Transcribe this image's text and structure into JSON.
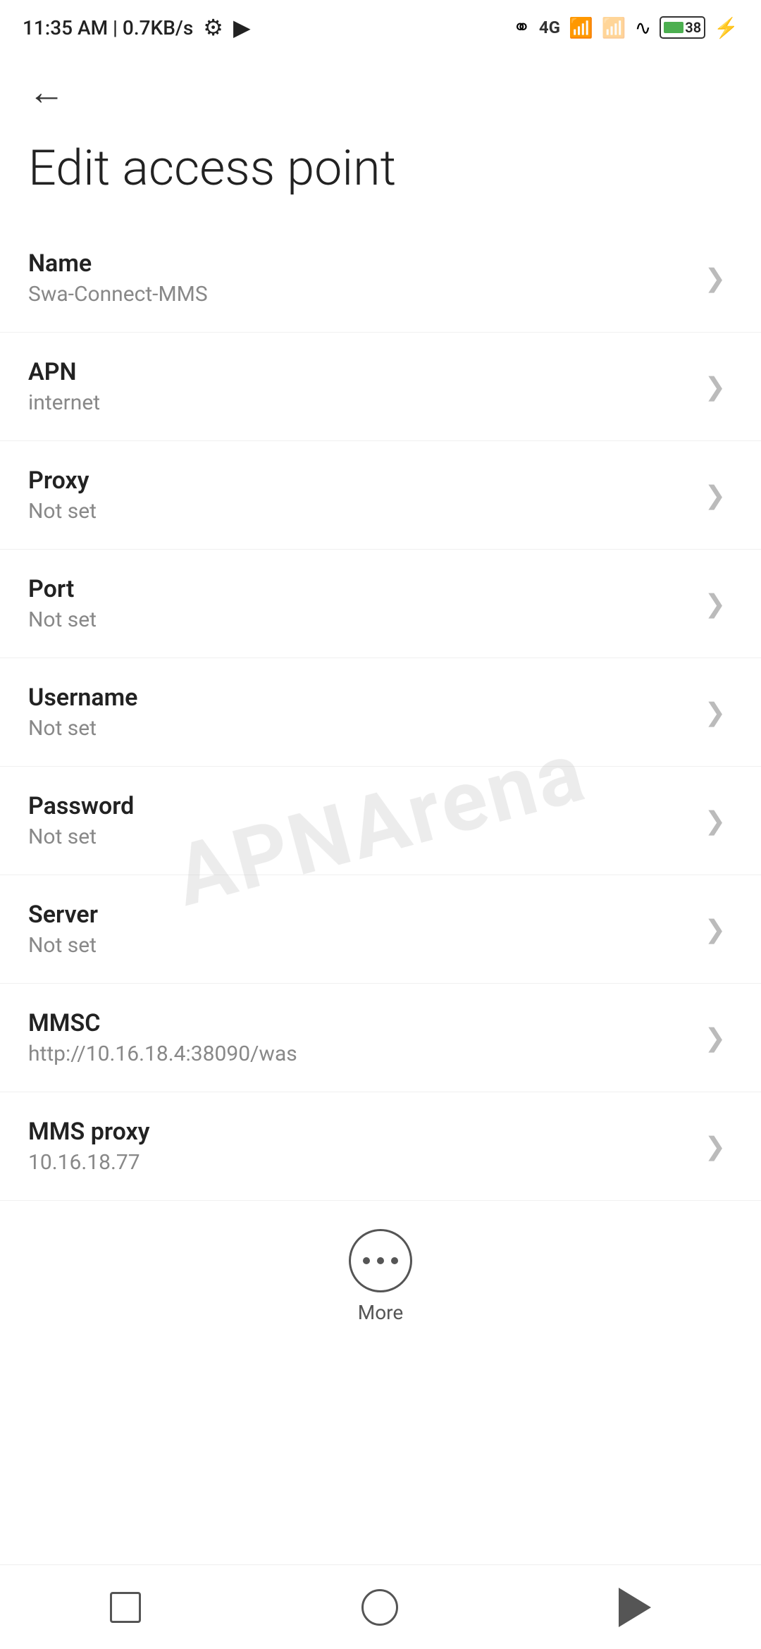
{
  "statusBar": {
    "time": "11:35 AM | 0.7KB/s",
    "icons": [
      "settings-icon",
      "video-icon",
      "bluetooth-icon",
      "signal-4g-icon",
      "signal-bars-icon",
      "wifi-icon",
      "battery-icon",
      "bolt-icon"
    ]
  },
  "page": {
    "title": "Edit access point",
    "back_label": "Back"
  },
  "settings": [
    {
      "label": "Name",
      "value": "Swa-Connect-MMS"
    },
    {
      "label": "APN",
      "value": "internet"
    },
    {
      "label": "Proxy",
      "value": "Not set"
    },
    {
      "label": "Port",
      "value": "Not set"
    },
    {
      "label": "Username",
      "value": "Not set"
    },
    {
      "label": "Password",
      "value": "Not set"
    },
    {
      "label": "Server",
      "value": "Not set"
    },
    {
      "label": "MMSC",
      "value": "http://10.16.18.4:38090/was"
    },
    {
      "label": "MMS proxy",
      "value": "10.16.18.77"
    }
  ],
  "more": {
    "label": "More"
  },
  "watermark": "APNArena",
  "bottomNav": {
    "square_label": "Recent apps",
    "circle_label": "Home",
    "triangle_label": "Back"
  }
}
